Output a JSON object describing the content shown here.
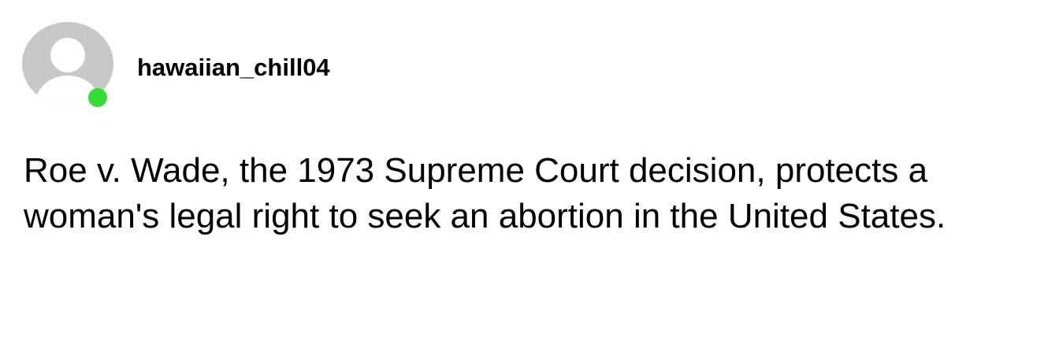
{
  "post": {
    "username": "hawaiian_chill04",
    "status": "online",
    "avatar_icon": "default-user-avatar-icon",
    "presence_color": "#33dd33",
    "body": "Roe v. Wade, the 1973 Supreme Court decision, protects a woman's legal right to seek an abortion in the United States."
  }
}
